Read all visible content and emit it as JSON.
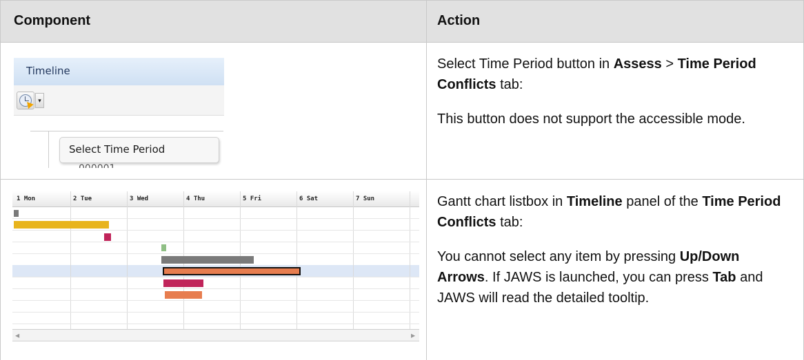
{
  "table": {
    "headers": {
      "component": "Component",
      "action": "Action"
    },
    "row1": {
      "screenshot": {
        "title": "Timeline",
        "dropdown_glyph": "▾",
        "tooltip": "Select Time Period",
        "partial_text": "000001"
      },
      "action": {
        "p1_part1": "Select Time Period button in ",
        "p1_bold1": "Assess",
        "p1_sep": " > ",
        "p1_bold2": "Time Period Conflicts",
        "p1_part2": " tab:",
        "p2": "This button does not support the accessible mode."
      }
    },
    "row2": {
      "gantt": {
        "days": [
          "1 Mon",
          "2 Tue",
          "3 Wed",
          "4 Thu",
          "5 Fri",
          "6 Sat",
          "7 Sun"
        ],
        "colors": {
          "gold": "#e8b41c",
          "crimson": "#c0245a",
          "green": "#8fbf85",
          "gray": "#7a7a7a",
          "orange": "#e77d4f",
          "selected_row": "#dde7f6"
        }
      },
      "action": {
        "p1_part1": "Gantt chart listbox in ",
        "p1_bold1": "Timeline",
        "p1_part2": " panel of the ",
        "p1_bold2": "Time Period Conflicts",
        "p1_part3": " tab:",
        "p2_part1": "You cannot select any item by pressing ",
        "p2_bold1": "Up/Down Arrows",
        "p2_part2": ". If JAWS is launched, you can press ",
        "p2_bold2": "Tab",
        "p2_part3": " and JAWS will read the detailed tooltip."
      }
    }
  }
}
